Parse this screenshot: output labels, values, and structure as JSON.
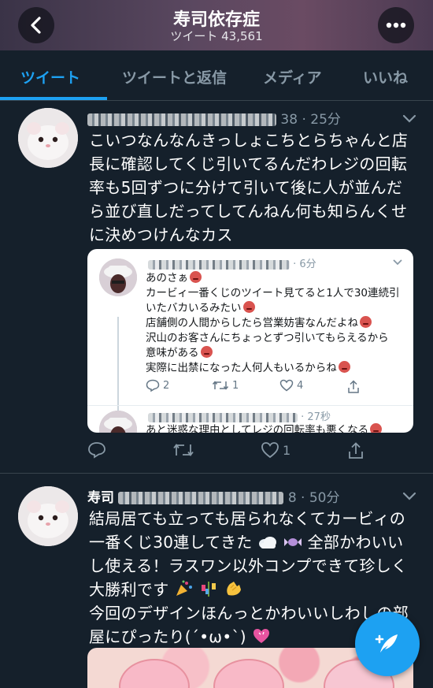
{
  "header": {
    "title": "寿司依存症",
    "subtitle": "ツイート 43,561"
  },
  "tabs": [
    {
      "label": "ツイート",
      "active": true
    },
    {
      "label": "ツイートと返信",
      "active": false
    },
    {
      "label": "メディア",
      "active": false
    },
    {
      "label": "いいね",
      "active": false
    }
  ],
  "tweets": [
    {
      "meta_tail": "38 · 25分",
      "text_lines": [
        "こいつなんなんきっしょこちとらちゃんと店",
        "長に確認してくじ引いてるんだわレジの回転",
        "率も5回ずつに分けて引いて後に人が並んだ",
        "ら並び直しだってしてんねん何も知らんくせ",
        "に決めつけんなカス"
      ],
      "embed": {
        "first": {
          "meta_tail": "· 6分",
          "lines": [
            "あのさぁ",
            "カービィ一番くじのツイート見てると1人で30連続引",
            "いたバカいるみたい",
            "店舗側の人間からしたら営業妨害なんだよね",
            "沢山のお客さんにちょっとずつ引いてもらえるから",
            "意味がある",
            "実際に出禁になった人何人もいるからね"
          ],
          "reply_count": "2",
          "retweet_count": "1",
          "like_count": "4"
        },
        "second": {
          "meta_tail": "· 27秒",
          "line": "あと迷惑な理由としてレジの回転率も悪くなる"
        }
      },
      "reply_count": "",
      "retweet_count": "",
      "like_count": "1"
    },
    {
      "name_visible": "寿司",
      "meta_tail": "8 · 50分",
      "text_lines": [
        "結局居ても立っても居られなくてカービィの",
        "一番くじ30連してきた",
        "全部かわいい",
        "し使える！ラスワン以外コンプできて珍しく",
        "大勝利です",
        "今回のデザインほんっとかわいいしわしの部",
        "屋にぴったり(´•ω•`)"
      ]
    }
  ],
  "icons": {
    "back": "chevron-left-icon",
    "more": "more-horizontal-icon",
    "caret": "chevron-down-icon",
    "reply": "reply-icon",
    "retweet": "retweet-icon",
    "like": "heart-icon",
    "share": "share-icon",
    "compose": "compose-feather-icon"
  },
  "colors": {
    "background": "#15202b",
    "accent": "#1da1f2",
    "muted": "#8899a6",
    "divider": "#38444d"
  }
}
